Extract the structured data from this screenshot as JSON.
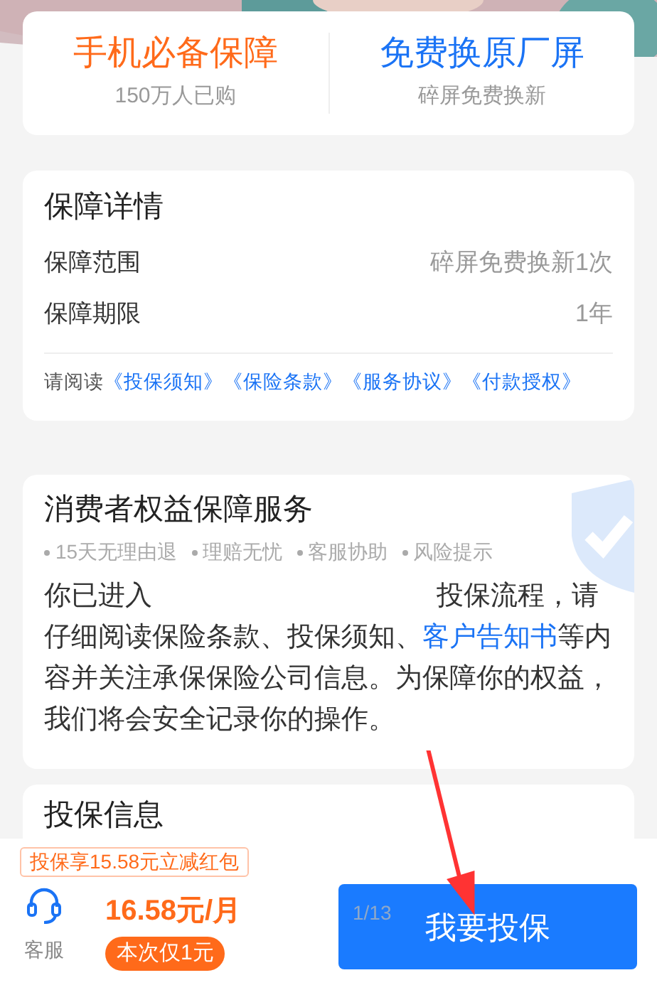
{
  "highlights": [
    {
      "title": "手机必备保障",
      "subtitle": "150万人已购",
      "color": "#ff6a1a"
    },
    {
      "title": "免费换原厂屏",
      "subtitle": "碎屏免费换新",
      "color": "#1a73f5"
    }
  ],
  "details": {
    "title": "保障详情",
    "rows": [
      {
        "label": "保障范围",
        "value": "碎屏免费换新1次"
      },
      {
        "label": "保障期限",
        "value": "1年"
      }
    ],
    "read_prefix": "请阅读",
    "documents": [
      "《投保须知》",
      "《保险条款》",
      "《服务协议》",
      "《付款授权》"
    ]
  },
  "rights": {
    "title": "消费者权益保障服务",
    "tags": [
      "15天无理由退",
      "理赔无忧",
      "客服协助",
      "风险提示"
    ],
    "text_before": "你已进入",
    "text_after": "投保流程，请仔细阅读保险条款、投保须知、",
    "link": "客户告知书",
    "text_end": "等内容并关注承保保险公司信息。为保障你的权益，我们将会安全记录你的操作。"
  },
  "next_section": {
    "title": "投保信息"
  },
  "bottom_bar": {
    "promo": "投保享15.58元立减红包",
    "service_label": "客服",
    "price": "16.58元/月",
    "badge": "本次仅1元",
    "button": "我要投保",
    "counter": "1/13"
  }
}
